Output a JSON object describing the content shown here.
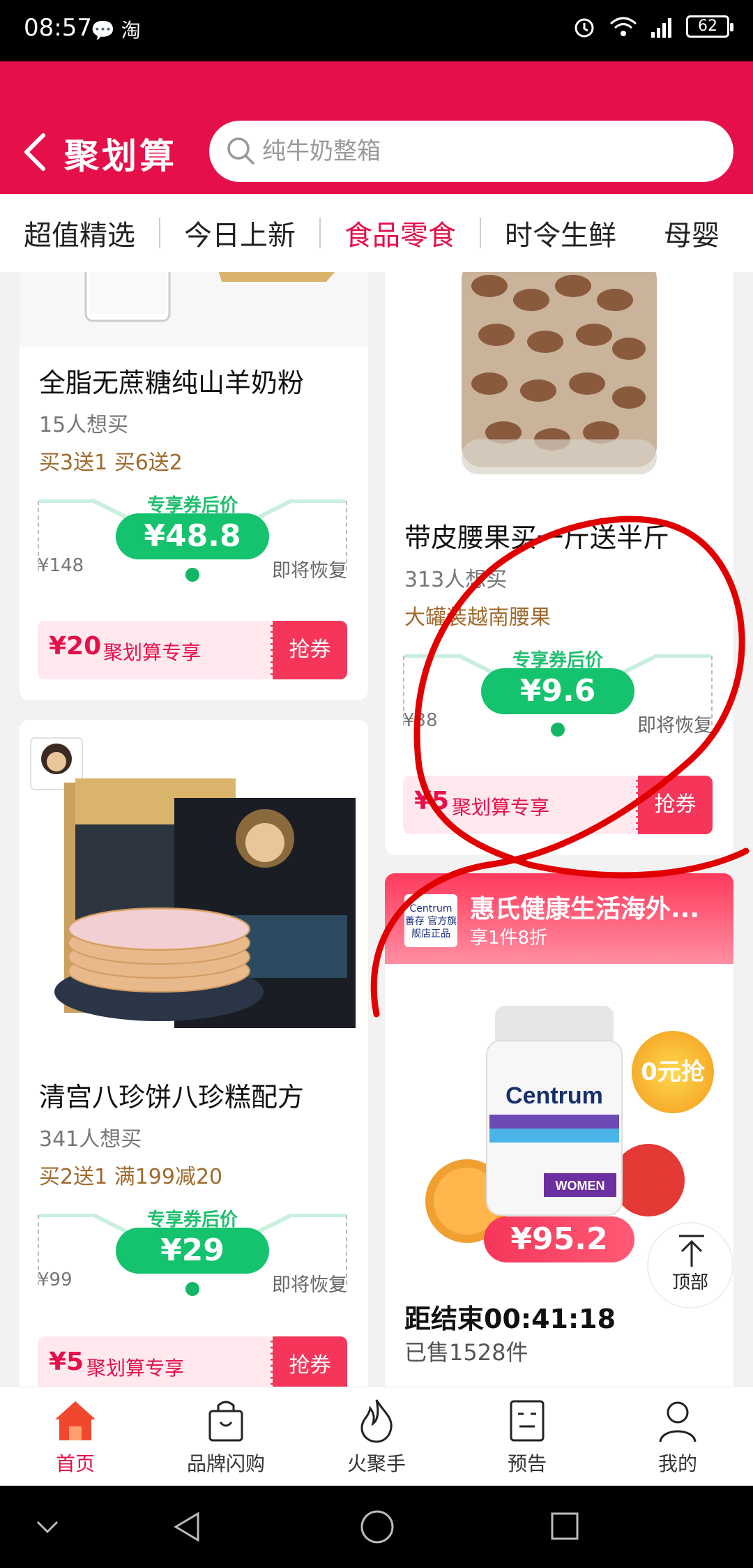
{
  "status_bar": {
    "time": "08:57",
    "app_icons": "💬 淘",
    "battery": "62"
  },
  "header": {
    "title": "聚划算",
    "search_placeholder": "纯牛奶整箱",
    "bg_color": "#e5104a"
  },
  "tabs": [
    {
      "label": "超值精选",
      "active": false
    },
    {
      "label": "今日上新",
      "active": false
    },
    {
      "label": "食品零食",
      "active": true
    },
    {
      "label": "时令生鲜",
      "active": false
    },
    {
      "label": "母婴",
      "active": false
    }
  ],
  "products": [
    {
      "title": "全脂无蔗糖纯山羊奶粉",
      "want": "15人想买",
      "promo": "买3送1 买6送2",
      "price_label": "专享券后价",
      "price": "¥48.8",
      "orig_price": "¥148",
      "restore": "即将恢复",
      "coupon_amount": "¥20",
      "coupon_desc": "聚划算专享",
      "coupon_btn": "抢券"
    },
    {
      "title": "带皮腰果买一斤送半斤",
      "want": "313人想买",
      "promo": "大罐装越南腰果",
      "price_label": "专享券后价",
      "price": "¥9.6",
      "orig_price": "¥38",
      "restore": "即将恢复",
      "coupon_amount": "¥5",
      "coupon_desc": "聚划算专享",
      "coupon_btn": "抢券"
    },
    {
      "title": "清宫八珍饼八珍糕配方",
      "want": "341人想买",
      "promo": "买2送1 满199减20",
      "price_label": "专享券后价",
      "price": "¥29",
      "orig_price": "¥99",
      "restore": "即将恢复",
      "coupon_amount": "¥5",
      "coupon_desc": "聚划算专享",
      "coupon_btn": "抢券"
    }
  ],
  "store_card": {
    "logo_text": "Centrum 善存 官方旗舰店正品",
    "name": "惠氏健康生活海外...",
    "discount": "享1件8折",
    "price": "¥95.2",
    "badge": "0元抢",
    "countdown": "距结束00:41:18",
    "sold": "已售1528件",
    "product_brand": "Centrum",
    "product_variant": "WOMEN"
  },
  "back_to_top": "顶部",
  "bottom_nav": [
    {
      "label": "首页",
      "icon": "home-icon",
      "active": true
    },
    {
      "label": "品牌闪购",
      "icon": "shopping-bag-icon",
      "active": false
    },
    {
      "label": "火聚手",
      "icon": "fire-icon",
      "active": false
    },
    {
      "label": "预告",
      "icon": "calendar-face-icon",
      "active": false
    },
    {
      "label": "我的",
      "icon": "user-icon",
      "active": false
    }
  ]
}
